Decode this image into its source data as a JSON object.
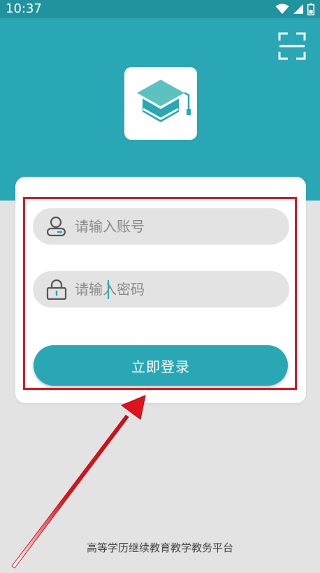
{
  "status_bar": {
    "time": "10:37",
    "icons": [
      "wifi-icon",
      "signal-icon",
      "battery-icon"
    ]
  },
  "header": {
    "scan_icon": "scan-icon",
    "logo_icon": "graduation-cap-icon"
  },
  "login_form": {
    "account_placeholder": "请输入账号",
    "account_icon": "user-icon",
    "password_placeholder": "请输入密码",
    "password_icon": "lock-icon",
    "submit_label": "立即登录"
  },
  "annotations": {
    "highlight_box_color": "#e0131c",
    "arrow_color": "#e0131c"
  },
  "footer": {
    "text": "高等学历继续教育教学教务平台"
  },
  "colors": {
    "accent": "#2aa7b4",
    "status_bar": "#20939f",
    "background": "#e3e3e3"
  }
}
